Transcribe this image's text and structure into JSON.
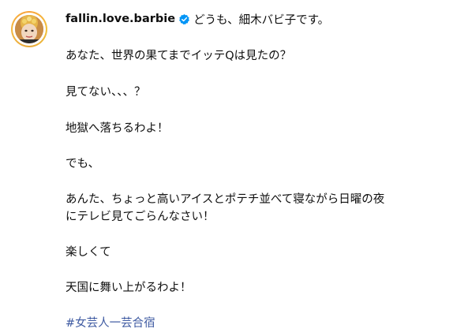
{
  "post": {
    "author": {
      "username": "fallin.love.barbie",
      "verified_icon": "verified-badge-icon",
      "avatar_ring_color": "#f5b944"
    },
    "caption": {
      "first_line": "どうも、細木バビ子です。",
      "lines": [
        "あなた、世界の果てまでイッテQは見たの？",
        "見てない、、、？",
        "地獄へ落ちるわよ！",
        "でも、",
        "あんた、ちょっと高いアイスとポテチ並べて寝ながら日曜の夜",
        "にテレビ見てごらんなさい！",
        "楽しくて",
        "天国に舞い上がるわよ！"
      ],
      "hashtag": "#女芸人一芸合宿"
    },
    "colors": {
      "text": "#0f0f0f",
      "hashtag": "#3d59a1",
      "verified": "#0095f6"
    }
  }
}
